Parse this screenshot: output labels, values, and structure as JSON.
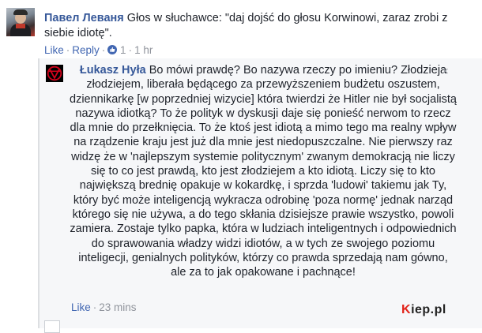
{
  "top_comment": {
    "author": "Павел Леваня",
    "text": "Głos w słuchawce: \"daj dojść do głosu Korwinowi, zaraz zrobi z siebie idiotę\".",
    "like_label": "Like",
    "reply_label": "Reply",
    "likes_count": "1",
    "time": "1 hr"
  },
  "reply_comment": {
    "author": "Łukasz Hyła",
    "text": "Bo mówi prawdę? Bo nazywa rzeczy po imieniu? Złodzieja złodziejem, liberała będącego za przewyższeniem budżetu oszustem, dziennikarkę [w poprzedniej wizycie] która twierdzi że Hitler nie był socjalistą nazywa idiotką? To że polityk w dyskusji daje się ponieść nerwom to rzecz dla mnie do przełknięcia. To że ktoś jest idiotą a mimo tego ma realny wpływ na rządzenie kraju jest już dla mnie jest niedopuszczalne. Nie pierwszy raz widzę że w 'najlepszym systemie politycznym' zwanym demokracją nie liczy się to co jest prawdą, kto jest złodziejem a kto idiotą. Liczy się to kto największą brednię opakuje w kokardkę, i sprzda 'ludowi' takiemu jak Ty, który być może inteligencją wykracza odrobinę 'poza normę' jednak narząd którego się nie używa, a do tego skłania dzisiejsze prawie wszystko, powoli zamiera. Zostaje tylko papka, która w ludziach inteligentnych i odpowiednich do sprawowania władzy widzi idiotów, a w tych ze swojego poziomu inteligecji, genialnych polityków, którzy co prawda sprzedają nam gówno, ale za to jak opakowane i pachnące!",
    "like_label": "Like",
    "time": "23 mins",
    "close_icon": "×"
  },
  "watermark": {
    "k": "K",
    "rest": "iep.pl"
  },
  "icons": {
    "reply_avatar": "circle-v-logo-icon",
    "close": "close-icon"
  },
  "colors": {
    "link": "#365899",
    "meta": "#90949c",
    "reply_bg": "#f6f7f9",
    "watermark_accent": "#e2231a"
  }
}
